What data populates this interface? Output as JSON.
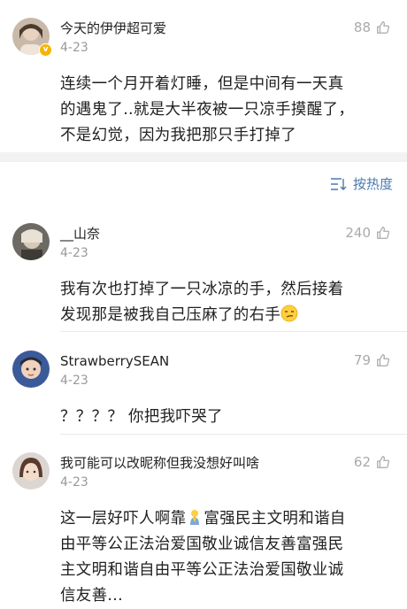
{
  "sort_label": "按热度",
  "comments": [
    {
      "user": "今天的伊伊超可爱",
      "date": "4-23",
      "likes": "88",
      "text_lines": [
        "连续一个月开着灯睡，但是中间有一天真",
        "的遇鬼了..就是大半夜被一只凉手摸醒了，",
        "不是幻觉，因为我把那只手打掉了"
      ]
    },
    {
      "user": "__山奈",
      "date": "4-23",
      "likes": "240",
      "text_lines": [
        "我有次也打掉了一只冰凉的手，然后接着",
        "发现那是被我自己压麻了的右手"
      ]
    },
    {
      "user": "StrawberrySEAN",
      "date": "4-23",
      "likes": "79",
      "text_lines": [
        "？？？？ 你把我吓哭了"
      ]
    },
    {
      "user": "我可能可以改昵称但我没想好叫啥",
      "date": "4-23",
      "likes": "62",
      "text_lines": [
        "这一层好吓人啊靠",
        "富强民主文明和谐自",
        "由平等公正法治爱国敬业诚信友善富强民",
        "主文明和谐自由平等公正法治爱国敬业诚",
        "信友善..."
      ]
    }
  ],
  "colors": {
    "link": "#4a78b0",
    "muted": "#999999",
    "badge": "#f5b400"
  },
  "icons": [
    "thumbs-up-icon",
    "sort-icon",
    "verified-badge-icon",
    "smirk-emoji",
    "praying-emoji"
  ]
}
